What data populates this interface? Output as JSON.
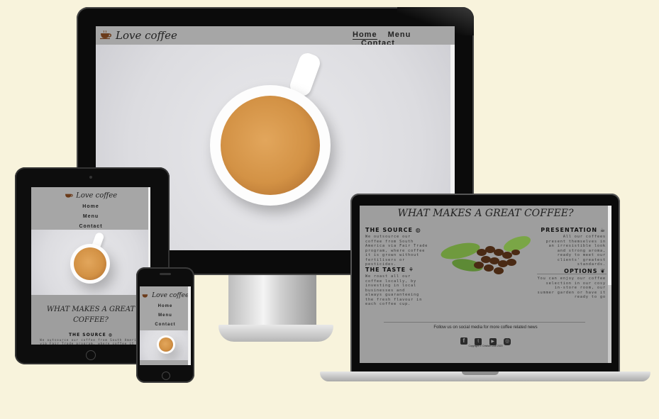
{
  "site": {
    "brand": "Love coffee"
  },
  "nav": {
    "home": "Home",
    "menu": "Menu",
    "contact": "Contact"
  },
  "section": {
    "heading": "WHAT MAKES A GREAT COFFEE?",
    "source_title": "THE SOURCE",
    "source_text": "We outsource our coffee from South America via Fair Trade program, where coffee it is grown without fertilisers or pesticides.",
    "taste_title": "THE TASTE",
    "taste_text": "We roast all our coffee locally, by investing in local businesses and always guaranteeing the fresh flavour in each coffee cup.",
    "presentation_title": "PRESENTATION",
    "presentation_text": "All our coffees present themselves in an irresistible look and strong aroma, ready to meet our clients' greatest standards.",
    "options_title": "OPTIONS",
    "options_text": "You can enjoy our coffee selection in our cosy in-store room, our summer garden or have it ready to go"
  },
  "footer": {
    "follow": "Follow us on social media for more coffee related news",
    "copyright": "Copyright © Cristian Ciuti 2020"
  },
  "tablet": {
    "source_text": "We outsource our coffee from South America via Fair Trade program, where coffee it is grown"
  },
  "colors": {
    "background": "#f8f3dc",
    "nav_bg": "#a6a6a6",
    "page_bg": "#9e9e9e",
    "crema": "#d39245"
  },
  "icons": [
    "coffee-cup-logo-icon",
    "globe-icon",
    "coffee-mug-icon",
    "seedling-icon",
    "leaf-icon",
    "facebook-icon",
    "twitter-icon",
    "youtube-icon",
    "instagram-icon"
  ]
}
